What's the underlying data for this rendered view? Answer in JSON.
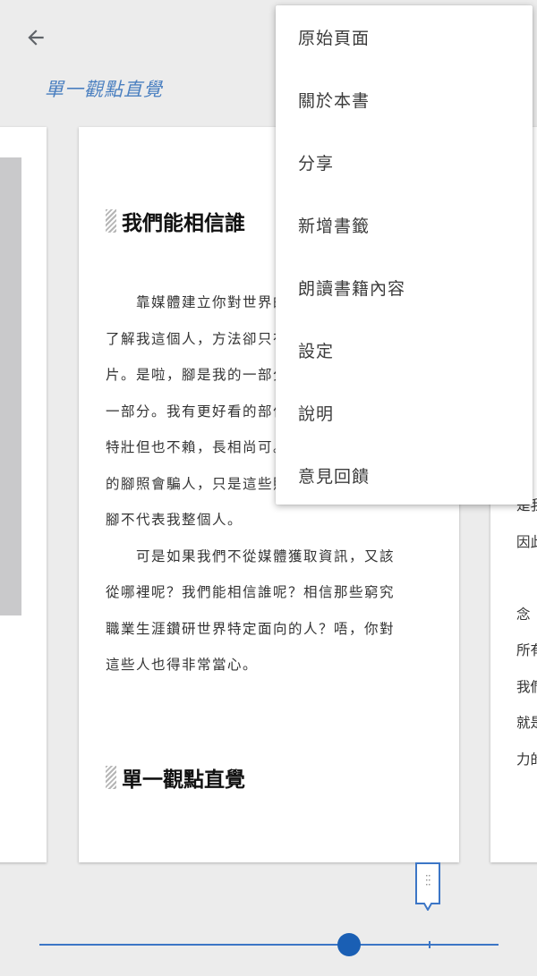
{
  "toolbar": {
    "back_icon": "arrow-left-icon"
  },
  "chapter_title": "單一觀點直覺",
  "page": {
    "heading1": "我們能相信誰",
    "lines": [
      "　　靠媒體建立你對世界的看法，就像想靠",
      "了解我這個人，方法卻只有看我的腳的照",
      "片。是啦，腳是我的一部分，但只是一小",
      "一部分。我有更好看的部位，例如我的臉，",
      "特壯但也不賴，長相尚可。我光是看我腳",
      "的腳照會騙人，只是這些照片只呈現了我",
      "腳不代表我整個人。",
      "　　可是如果我們不從媒體獲取資訊，又該",
      "從哪裡呢？我們能相信誰呢？相信那些窮究",
      "職業生涯鑽研世界特定面向的人？唔，你對",
      "這些人也得非常當心。"
    ],
    "heading2": "單一觀點直覺"
  },
  "right_page": {
    "lines": [
      "",
      "",
      "",
      "",
      "",
      "",
      "",
      "",
      "",
      "",
      "是我",
      "因此",
      "",
      "念　",
      "所有",
      "我們",
      "就是",
      "力的"
    ]
  },
  "menu": {
    "items": [
      "原始頁面",
      "關於本書",
      "分享",
      "新增書籤",
      "朗讀書籍內容",
      "設定",
      "說明",
      "意見回饋"
    ]
  },
  "progress": {
    "position": 0.675,
    "bookmark_position": 0.85
  },
  "colors": {
    "accent": "#1a5fb4",
    "title": "#4a7fc0",
    "background": "#ececec"
  }
}
